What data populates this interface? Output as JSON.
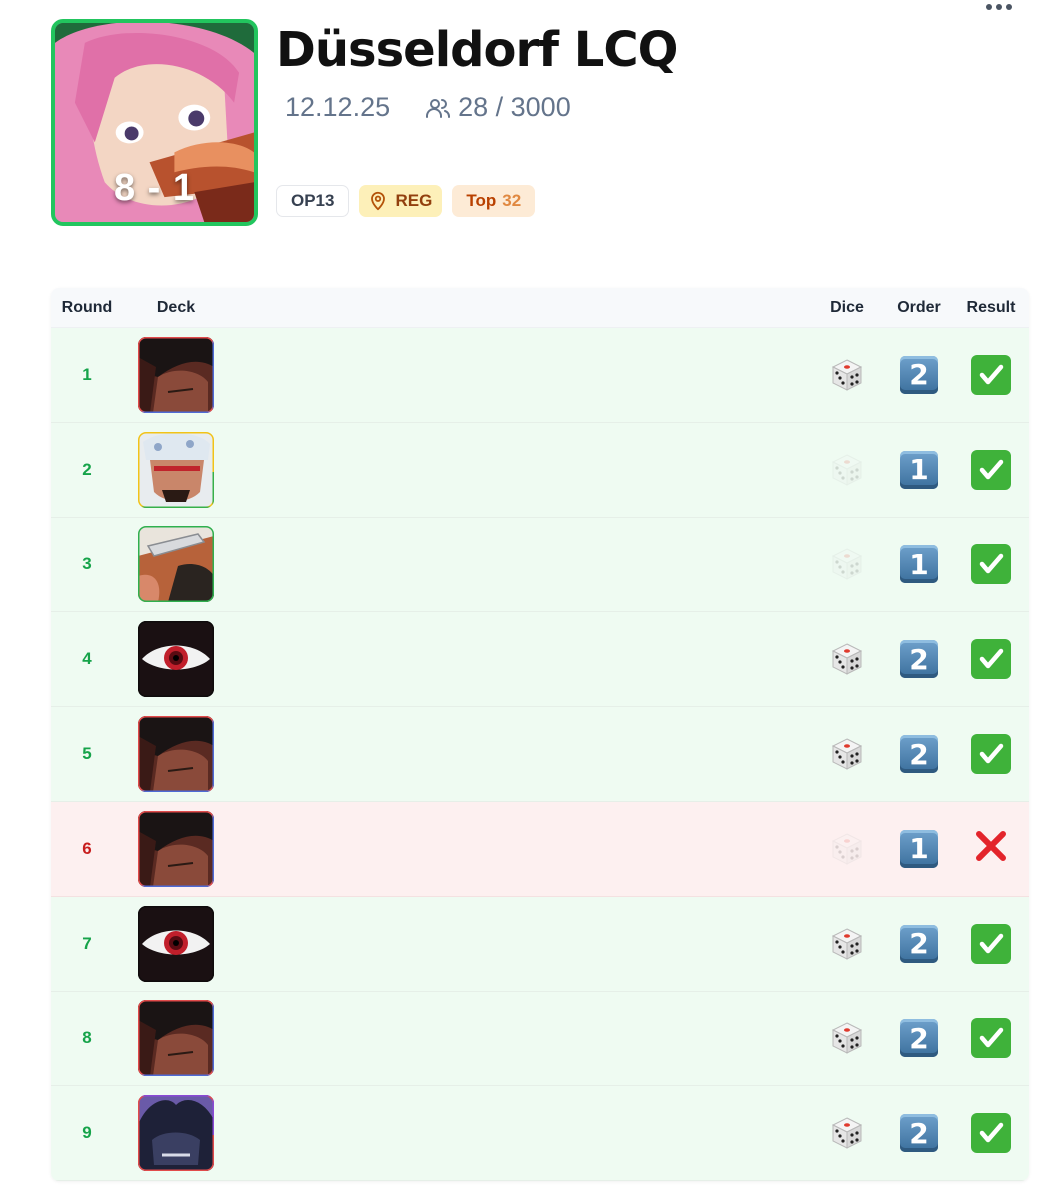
{
  "event": {
    "title": "Düsseldorf LCQ",
    "date": "12.12.25",
    "players": "28 / 3000",
    "record": "8 - 1",
    "badges": {
      "set": "OP13",
      "type": "REG",
      "placement_label": "Top",
      "placement_value": "32"
    }
  },
  "table": {
    "headers": {
      "round": "Round",
      "deck": "Deck",
      "dice": "Dice",
      "order": "Order",
      "result": "Result"
    },
    "rows": [
      {
        "round": "1",
        "deck": "leader-red-dark-hair",
        "dice_won": true,
        "order": "2",
        "result": "win"
      },
      {
        "round": "2",
        "deck": "leader-yellow-green-hat",
        "dice_won": false,
        "order": "1",
        "result": "win"
      },
      {
        "round": "3",
        "deck": "leader-green-sword",
        "dice_won": false,
        "order": "1",
        "result": "win"
      },
      {
        "round": "4",
        "deck": "leader-black-eye",
        "dice_won": true,
        "order": "2",
        "result": "win"
      },
      {
        "round": "5",
        "deck": "leader-red-dark-hair",
        "dice_won": true,
        "order": "2",
        "result": "win"
      },
      {
        "round": "6",
        "deck": "leader-red-dark-hair",
        "dice_won": false,
        "order": "1",
        "result": "loss"
      },
      {
        "round": "7",
        "deck": "leader-black-eye",
        "dice_won": true,
        "order": "2",
        "result": "win"
      },
      {
        "round": "8",
        "deck": "leader-red-dark-hair",
        "dice_won": true,
        "order": "2",
        "result": "win"
      },
      {
        "round": "9",
        "deck": "leader-red-purple-wild-hair",
        "dice_won": true,
        "order": "2",
        "result": "win"
      }
    ]
  },
  "icons": {
    "more": "more-horizontal-icon",
    "players": "users-icon",
    "location": "map-pin-icon",
    "dice": "dice-icon",
    "win": "check-mark-icon",
    "loss": "cross-mark-icon"
  },
  "colors": {
    "win_row": "#effbf2",
    "loss_row": "#fdf0f0",
    "win_text": "#16a34a",
    "loss_text": "#c81e1e",
    "hero_border": "#22c55e"
  }
}
